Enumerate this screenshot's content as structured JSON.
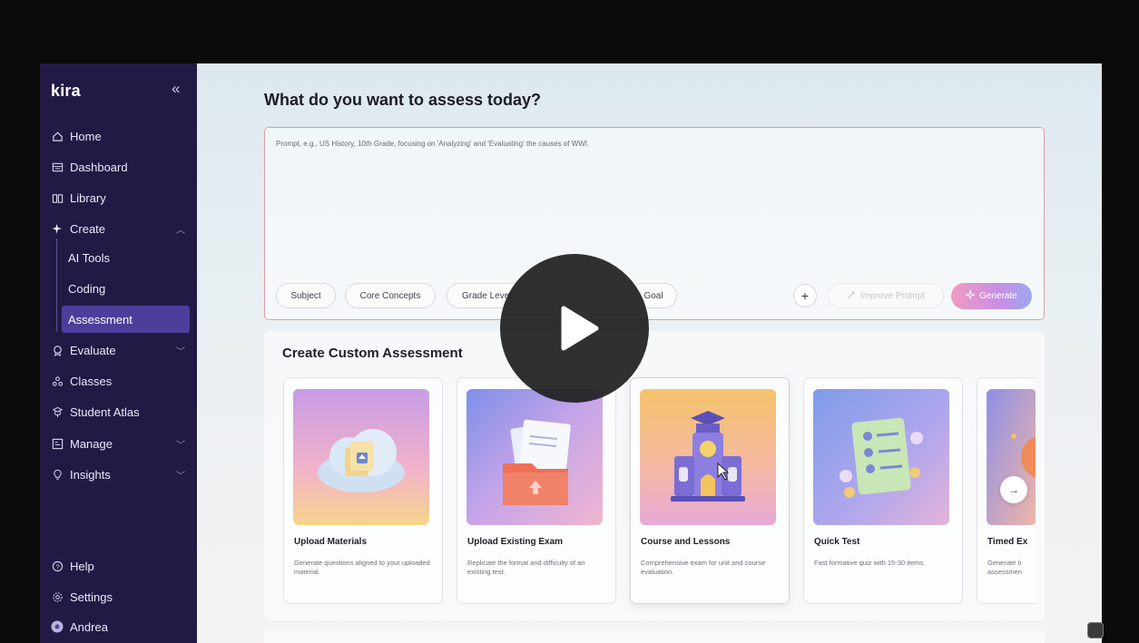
{
  "app": {
    "logo": "kira",
    "collapse_glyph": "«"
  },
  "sidebar": {
    "items": [
      {
        "label": "Home",
        "icon": "home-icon"
      },
      {
        "label": "Dashboard",
        "icon": "dashboard-icon"
      },
      {
        "label": "Library",
        "icon": "book-icon"
      },
      {
        "label": "Create",
        "icon": "sparkle-icon"
      },
      {
        "label": "Evaluate",
        "icon": "badge-icon"
      },
      {
        "label": "Classes",
        "icon": "users-icon"
      },
      {
        "label": "Student Atlas",
        "icon": "atlas-icon"
      },
      {
        "label": "Manage",
        "icon": "manage-icon"
      },
      {
        "label": "Insights",
        "icon": "bulb-icon"
      }
    ],
    "create_subitems": [
      "AI Tools",
      "Coding",
      "Assessment"
    ],
    "bottom": [
      {
        "label": "Help",
        "icon": "help-icon"
      },
      {
        "label": "Settings",
        "icon": "settings-icon"
      },
      {
        "label": "Andrea",
        "icon": "avatar-icon"
      }
    ]
  },
  "main": {
    "title": "What do you want to assess today?",
    "prompt_placeholder": "Prompt, e.g., US History, 10th Grade, focusing on 'Analyzing' and 'Evaluating' the causes of WWI.",
    "chips": [
      "Subject",
      "Core Concepts",
      "Grade Level",
      "Goal"
    ],
    "plus_label": "+",
    "improve_label": "Improve Prompt",
    "generate_label": "Generate",
    "section_title": "Create Custom Assessment",
    "cards": [
      {
        "title": "Upload Materials",
        "desc": "Generate questions aligned to your uploaded material."
      },
      {
        "title": "Upload Existing Exam",
        "desc": "Replicate the format and difficulty of an existing test."
      },
      {
        "title": "Course and Lessons",
        "desc": "Comprehensive exam for unit and course evaluation."
      },
      {
        "title": "Quick Test",
        "desc": "Fast formative quiz with 15-30 items."
      },
      {
        "title": "Timed Ex",
        "desc": "Generate ti assessmen"
      }
    ],
    "next_glyph": "→"
  },
  "colors": {
    "sidebar_bg": "#221a45",
    "active_item": "#4c3f9b",
    "prompt_border": "#d8a0ad"
  }
}
